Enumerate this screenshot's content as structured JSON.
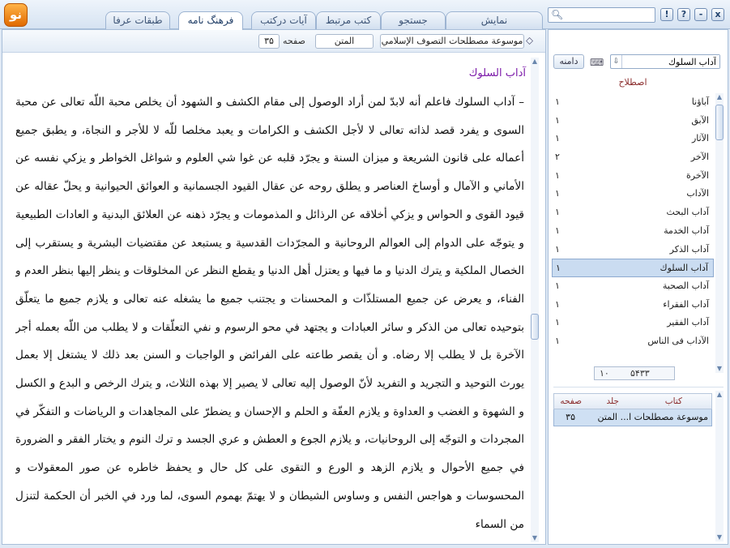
{
  "app": {
    "logo_text": "نو"
  },
  "tabs": [
    {
      "label": "نمایش"
    },
    {
      "label": "جستجو"
    },
    {
      "label": "كتب مرتبط"
    },
    {
      "label": "آیات درکتب"
    },
    {
      "label": "فرهنگ نامه"
    },
    {
      "label": "طبقات عرفا"
    }
  ],
  "search": {
    "value": ""
  },
  "window_buttons": [
    "!",
    "?",
    "-",
    "x"
  ],
  "breadcrumb": {
    "book": "موسوعة مصطلحات التصوف الإسلامي",
    "volume": "المتن",
    "page_label": "صفحه",
    "page": "۳۵"
  },
  "document": {
    "title": "آداب السلوك",
    "body": "– آداب السلوك فاعلم أنه لابدّ لمن أراد الوصول إلى مقام الكشف و الشهود أن يخلص محبة اللّه تعالى عن محبة السوى و يفرد قصد لذاته تعالى لا لأجل الكشف و الكرامات و يعبد مخلصا للّه لا للأجر و النجاة، و يطبق جميع أعماله على قانون الشريعة و ميزان السنة و يجرّد قلبه عن غوا شي العلوم و شواغل الخواطر و يزكي نفسه عن الأماني و الآمال و أوساخ العناصر و يطلق روحه عن عقال القيود الجسمانية و العوائق الحيوانية و يحلّ عقاله عن قيود القوى و الحواس و يزكي أخلاقه عن الرذائل و المذمومات و يجرّد ذهنه عن العلائق البدنية و العادات الطبيعية و يتوجّه على الدوام إلى العوالم الروحانية و المجرّدات القدسية و يستبعد عن مقتضيات البشرية و يستقرب إلى الخصال الملكية و يترك الدنيا و ما فيها و يعتزل أهل الدنيا و يقطع النظر عن المخلوقات و ينظر إليها بنظر العدم و الفناء، و يعرض عن جميع المستلذّات و المحسنات و يجتنب جميع ما يشغله عنه تعالى و يلازم جميع ما يتعلّق بتوحيده تعالى من الذكر و سائر العبادات و يجتهد في محو الرسوم و نفي التعلّقات و لا يطلب من اللّه بعمله أجر الآخرة بل لا يطلب إلا رضاه. و أن يقصر طاعته على الفرائض و الواجبات و السنن بعد ذلك لا يشتغل إلا بعمل يورث التوحيد و التجريد و التفريد لأنّ الوصول إليه تعالى لا يصير إلا بهذه الثلاث، و يترك الرخص و البدع و الكسل و الشهوة و الغضب و العداوة و يلازم العفّة و الحلم و الإحسان و يضطرّ على المجاهدات و الرياضات و التفكّر في المجردات و التوجّه إلى الروحانيات، و يلازم الجوع و العطش و عري الجسد و ترك النوم و يختار الفقر و الضرورة في جميع الأحوال و يلازم الزهد و الورع و التقوى على كل حال و يحفظ خاطره عن صور المعقولات و المحسوسات و هواجس النفس و وساوس الشيطان و لا يهتمّ بهموم السوى، لما ورد في الخبر أن الحكمة لتنزل من السماء"
  },
  "side_panel": {
    "search_value": "آداب السلوك",
    "scope_label": "دامنه",
    "list_header": "اصطلاح",
    "terms": [
      {
        "term": "آباؤنا",
        "count": "۱"
      },
      {
        "term": "الآبق",
        "count": "۱"
      },
      {
        "term": "الآثار",
        "count": "۱"
      },
      {
        "term": "الآخر",
        "count": "۲"
      },
      {
        "term": "الآخرة",
        "count": "۱"
      },
      {
        "term": "الآداب",
        "count": "۱"
      },
      {
        "term": "آداب البحث",
        "count": "۱"
      },
      {
        "term": "آداب الخدمة",
        "count": "۱"
      },
      {
        "term": "آداب الذكر",
        "count": "۱"
      },
      {
        "term": "آداب السلوك",
        "count": "۱",
        "selected": true
      },
      {
        "term": "آداب الصحبة",
        "count": "۱"
      },
      {
        "term": "آداب الفقراء",
        "count": "۱"
      },
      {
        "term": "آداب الفقير",
        "count": "۱"
      },
      {
        "term": "الآداب فى الناس",
        "count": "۱"
      }
    ],
    "pager": {
      "total": "۵۴۳۳",
      "current": "۱۰"
    },
    "sources_table": {
      "headers": {
        "book": "كتاب",
        "volume": "جلد",
        "page": "صفحه"
      },
      "rows": [
        {
          "book": "موسوعة مصطلحات ا...",
          "volume": "المتن",
          "page": "۳۵"
        }
      ]
    }
  }
}
